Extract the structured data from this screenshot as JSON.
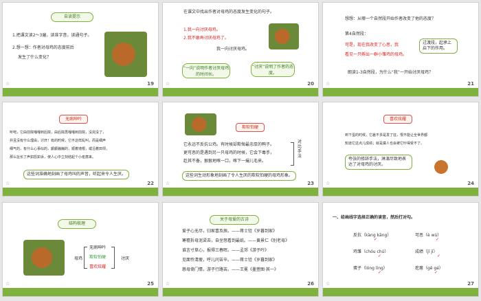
{
  "s19": {
    "num": "19",
    "title": "自读提示",
    "l1": "1.把课文读2～3遍，读准字音，读通句子。",
    "l2": "2.想一想：作者对母鸡的态度前后",
    "l3": "发生了什么变化？"
  },
  "s20": {
    "num": "20",
    "q": "在课文中找出作者对母鸡的态度发生变化的句子。",
    "a1": "1.我一向讨厌母鸡。",
    "a2": "2.我不敢再讨厌母鸡了。",
    "mid": "我一向讨厌母鸡。",
    "c1": "“一向”说明作者讨厌母鸡的时间长。",
    "c2": "“讨厌”说明了作者的态度。"
  },
  "s21": {
    "num": "21",
    "q": "想想：从哪一个自然段开始作者改变了他的态度？",
    "p": "第4自然段：",
    "r1": "可是，现在我改变了心思，我",
    "r2": "看见一只孵出一群小雏鸡的母鸡。",
    "note": "过渡段，起承上启下的作用。",
    "bottom": "朗读1-3自然段，为什么“我”一开始讨厌母鸡？"
  },
  "s22": {
    "num": "22",
    "title": "无病呻吟",
    "t1": "听吧，它由前院嘎嘎到后院，由后院再嘎嘎到前院，没完没了，",
    "t2": "并且没有什么理由，讨厌！有的时候，它不这样乱叫，而是细声",
    "t3": "细气的，有什么心事似的，颤颤巍巍的，顺着墙根，或沿着田坝，",
    "t4": "那么扯长了声如怨如诉，使人心中立刻结起个小疙瘩来。",
    "box": "这些词准确地刻画了母鸡叫的声音，听起来令人生厌。"
  },
  "s23": {
    "num": "23",
    "title": "欺软怕硬",
    "t1": "它永远不反抗公鸡。有时候却欺侮最忠厚的鸭子。",
    "t2": "更可恶的是遇到另一只母鸡的时候，它会下毒手，",
    "t3": "趁其不备，狠狠地啄一口，啄下一撮儿毛来。",
    "v": "对比手法",
    "box": "这些词生动形象地刻画了令人生厌的欺软怕硬的母鸡形象。"
  },
  "s24": {
    "num": "24",
    "title": "喜欢炫耀",
    "t1": "到下蛋的时候，它差不多是发了狂，恨不能让全世界都",
    "t2": "知道它这点儿成绩；就是聋人也会被它吵得受不了。",
    "box": "夸张的修辞手法，淋漓尽致地表达了对母鸡的讨厌。"
  },
  "s25": {
    "num": "25",
    "title": "结构梳理",
    "root": "母鸡",
    "b1": "无病呻吟",
    "b2": "欺软怕硬",
    "b3": "喜欢炫耀",
    "end": "讨厌"
  },
  "s26": {
    "num": "26",
    "title": "关于母爱的古诗",
    "p1": "爱子心无尽，归家喜及辰。——蒋士铨《岁暮到家》",
    "p2": "寒檐拆母泥梁去，自坐怒看到最纸。——黄景仁《别老母》",
    "p3": "谁言寸草心，报得三春晖。——孟郊《游子吟》",
    "p4": "见面怜清瘦，呼儿问苦辛。——蒋士铨《岁暮到家》",
    "p5": "慈母倚门情，游子行路苦。——王冕《墨萱图·其一》"
  },
  "s27": {
    "num": "27",
    "title": "一、给画线字选择正确的读音，然后打对勾。",
    "w1": "反抗（kàng  kāng）",
    "w2": "可恶（è  wù）",
    "w3": "鸡雏（chóu  chú）",
    "w4": "成绩（jī  jì）",
    "w5": "蛋子（lóng  líng）",
    "w6": "疙瘩（gē  gé）"
  }
}
